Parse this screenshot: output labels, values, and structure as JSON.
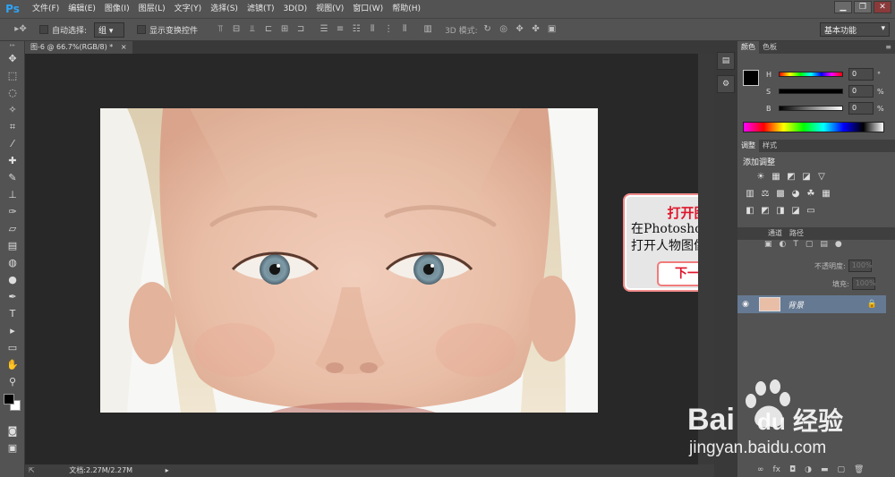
{
  "app": {
    "logo": "Ps"
  },
  "menu": [
    "文件(F)",
    "编辑(E)",
    "图像(I)",
    "图层(L)",
    "文字(Y)",
    "选择(S)",
    "滤镜(T)",
    "3D(D)",
    "视图(V)",
    "窗口(W)",
    "帮助(H)"
  ],
  "window_controls": {
    "minimize": "▁",
    "restore": "❐",
    "close": "✕"
  },
  "options": {
    "auto_select_label": "自动选择:",
    "auto_select_value": "组",
    "show_transform_label": "显示变换控件",
    "mode_3d_label": "3D 模式:",
    "workspace": "基本功能"
  },
  "document": {
    "tab_title": "图-6 @ 66.7%(RGB/8) *",
    "status": "文档:2.27M/2.27M"
  },
  "color_panel": {
    "tabs": [
      "颜色",
      "色板"
    ],
    "sliders": [
      {
        "label": "H",
        "value": "0",
        "unit": "°"
      },
      {
        "label": "S",
        "value": "0",
        "unit": "%"
      },
      {
        "label": "B",
        "value": "0",
        "unit": "%"
      }
    ]
  },
  "adjust_panel": {
    "tabs": [
      "调整",
      "样式"
    ],
    "title": "添加调整"
  },
  "layers_panel": {
    "tabs": [
      "通道",
      "路径"
    ],
    "opacity_label": "不透明度:",
    "opacity_value": "100%",
    "fill_label": "填充:",
    "fill_value": "100%",
    "layer_name": "背景"
  },
  "callout": {
    "title": "打开图像",
    "body_line1": "在Photoshop中",
    "body_line2": "打开人物图像。",
    "button": "下一步"
  },
  "watermark": {
    "brand_left": "Bai",
    "brand_right": "du",
    "brand_cn": "经验",
    "url": "jingyan.baidu.com"
  },
  "colors": {
    "accent_red": "#e0162b",
    "callout_border": "#f18a8a",
    "ps_blue": "#2fa3f5",
    "layer_selected": "#657992"
  }
}
